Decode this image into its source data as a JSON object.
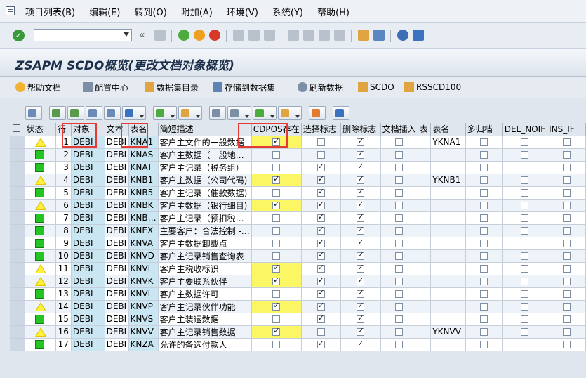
{
  "menu": [
    "项目列表(B)",
    "编辑(E)",
    "转到(O)",
    "附加(A)",
    "环境(V)",
    "系统(Y)",
    "帮助(H)"
  ],
  "toolbar": {
    "ok_symbol": "✓",
    "chevron": "«"
  },
  "title": "ZSAPM SCDO概览(更改文档对象概览)",
  "app_buttons": [
    "帮助文档",
    "配置中心",
    "数据集目录",
    "存储到数据集",
    "刷新数据",
    "SCDO",
    "RSSCD100"
  ],
  "columns": [
    "状态",
    "行",
    "对象",
    "文本",
    "表名",
    "简短描述",
    "CDPOS存在",
    "选择标志",
    "删除标志",
    "文档插入",
    "表",
    "表名",
    "多归档",
    "DEL_NOIF",
    "INS_IF"
  ],
  "rows": [
    {
      "status": "warning",
      "row": "1",
      "obj": "DEBI",
      "text": "DEBI",
      "table": "KNA1",
      "desc": "客户主文件的一般数据",
      "cdpos": true,
      "sel": false,
      "del": true,
      "ins": false,
      "tab": "",
      "tname": "YKNA1"
    },
    {
      "status": "ok",
      "row": "2",
      "obj": "DEBI",
      "text": "DEBI",
      "table": "KNAS",
      "desc": "客户主数据（一般地…",
      "cdpos": false,
      "sel": false,
      "del": true,
      "ins": false,
      "tab": "",
      "tname": ""
    },
    {
      "status": "ok",
      "row": "3",
      "obj": "DEBI",
      "text": "DEBI",
      "table": "KNAT",
      "desc": "客户主记录（税务组）",
      "cdpos": false,
      "sel": true,
      "del": true,
      "ins": false,
      "tab": "",
      "tname": ""
    },
    {
      "status": "warning",
      "row": "4",
      "obj": "DEBI",
      "text": "DEBI",
      "table": "KNB1",
      "desc": "客户主数据（公司代码)",
      "cdpos": true,
      "sel": true,
      "del": true,
      "ins": false,
      "tab": "",
      "tname": "YKNB1"
    },
    {
      "status": "ok",
      "row": "5",
      "obj": "DEBI",
      "text": "DEBI",
      "table": "KNB5",
      "desc": "客户主记录（催款数据)",
      "cdpos": false,
      "sel": true,
      "del": true,
      "ins": false,
      "tab": "",
      "tname": ""
    },
    {
      "status": "warning",
      "row": "6",
      "obj": "DEBI",
      "text": "DEBI",
      "table": "KNBK",
      "desc": "客户主数据（银行细目)",
      "cdpos": true,
      "sel": true,
      "del": true,
      "ins": false,
      "tab": "",
      "tname": ""
    },
    {
      "status": "ok",
      "row": "7",
      "obj": "DEBI",
      "text": "DEBI",
      "table": "KNB…",
      "desc": "客户主记录（预扣税…",
      "cdpos": false,
      "sel": true,
      "del": true,
      "ins": false,
      "tab": "",
      "tname": ""
    },
    {
      "status": "ok",
      "row": "8",
      "obj": "DEBI",
      "text": "DEBI",
      "table": "KNEX",
      "desc": "主要客户：合法控制 -…",
      "cdpos": false,
      "sel": true,
      "del": true,
      "ins": false,
      "tab": "",
      "tname": ""
    },
    {
      "status": "ok",
      "row": "9",
      "obj": "DEBI",
      "text": "DEBI",
      "table": "KNVA",
      "desc": "客户主数据卸载点",
      "cdpos": false,
      "sel": true,
      "del": true,
      "ins": false,
      "tab": "",
      "tname": ""
    },
    {
      "status": "ok",
      "row": "10",
      "obj": "DEBI",
      "text": "DEBI",
      "table": "KNVD",
      "desc": "客户主记录销售查询表",
      "cdpos": false,
      "sel": true,
      "del": true,
      "ins": false,
      "tab": "",
      "tname": ""
    },
    {
      "status": "warning",
      "row": "11",
      "obj": "DEBI",
      "text": "DEBI",
      "table": "KNVI",
      "desc": "客户主税收标识",
      "cdpos": true,
      "sel": true,
      "del": true,
      "ins": false,
      "tab": "",
      "tname": ""
    },
    {
      "status": "warning",
      "row": "12",
      "obj": "DEBI",
      "text": "DEBI",
      "table": "KNVK",
      "desc": "客户主要联系伙伴",
      "cdpos": true,
      "sel": true,
      "del": true,
      "ins": false,
      "tab": "",
      "tname": ""
    },
    {
      "status": "ok",
      "row": "13",
      "obj": "DEBI",
      "text": "DEBI",
      "table": "KNVL",
      "desc": "客户主数据许可",
      "cdpos": false,
      "sel": true,
      "del": true,
      "ins": false,
      "tab": "",
      "tname": ""
    },
    {
      "status": "warning",
      "row": "14",
      "obj": "DEBI",
      "text": "DEBI",
      "table": "KNVP",
      "desc": "客户主记录伙伴功能",
      "cdpos": true,
      "sel": true,
      "del": true,
      "ins": false,
      "tab": "",
      "tname": ""
    },
    {
      "status": "ok",
      "row": "15",
      "obj": "DEBI",
      "text": "DEBI",
      "table": "KNVS",
      "desc": "客户主装运数据",
      "cdpos": false,
      "sel": true,
      "del": true,
      "ins": false,
      "tab": "",
      "tname": ""
    },
    {
      "status": "warning",
      "row": "16",
      "obj": "DEBI",
      "text": "DEBI",
      "table": "KNVV",
      "desc": "客户主记录销售数据",
      "cdpos": true,
      "sel": false,
      "del": true,
      "ins": false,
      "tab": "",
      "tname": "YKNVV"
    },
    {
      "status": "ok",
      "row": "17",
      "obj": "DEBI",
      "text": "DEBI",
      "table": "KNZA",
      "desc": "允许的备选付款人",
      "cdpos": false,
      "sel": true,
      "del": true,
      "ins": false,
      "tab": "",
      "tname": ""
    }
  ],
  "colors": {
    "key_column": "#c9e6f2",
    "cdpos_highlight": "#fbf664",
    "annotation_box": "#e53b35"
  }
}
